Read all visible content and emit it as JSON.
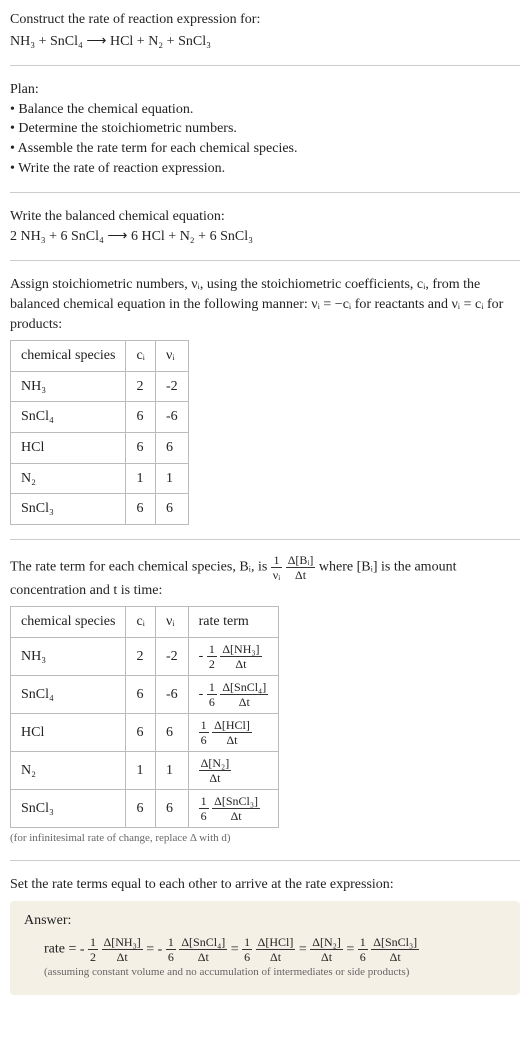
{
  "prompt": {
    "title": "Construct the rate of reaction expression for:",
    "equation": "NH₃ + SnCl₄ ⟶ HCl + N₂ + SnCl₃"
  },
  "plan": {
    "title": "Plan:",
    "items": [
      "• Balance the chemical equation.",
      "• Determine the stoichiometric numbers.",
      "• Assemble the rate term for each chemical species.",
      "• Write the rate of reaction expression."
    ]
  },
  "balanced": {
    "title": "Write the balanced chemical equation:",
    "equation": "2 NH₃ + 6 SnCl₄ ⟶ 6 HCl + N₂ + 6 SnCl₃"
  },
  "assign": {
    "intro": "Assign stoichiometric numbers, νᵢ, using the stoichiometric coefficients, cᵢ, from the balanced chemical equation in the following manner: νᵢ = −cᵢ for reactants and νᵢ = cᵢ for products:",
    "headers": [
      "chemical species",
      "cᵢ",
      "νᵢ"
    ],
    "rows": [
      {
        "sp": "NH₃",
        "c": "2",
        "v": "-2"
      },
      {
        "sp": "SnCl₄",
        "c": "6",
        "v": "-6"
      },
      {
        "sp": "HCl",
        "c": "6",
        "v": "6"
      },
      {
        "sp": "N₂",
        "c": "1",
        "v": "1"
      },
      {
        "sp": "SnCl₃",
        "c": "6",
        "v": "6"
      }
    ]
  },
  "rateterm": {
    "intro_a": "The rate term for each chemical species, Bᵢ, is ",
    "frac1_num": "1",
    "frac1_den": "νᵢ",
    "frac2_num": "Δ[Bᵢ]",
    "frac2_den": "Δt",
    "intro_b": " where [Bᵢ] is the amount concentration and t is time:",
    "headers": [
      "chemical species",
      "cᵢ",
      "νᵢ",
      "rate term"
    ],
    "rows": [
      {
        "sp": "NH₃",
        "c": "2",
        "v": "-2",
        "coef": "- ",
        "cn": "1",
        "cd": "2",
        "bn": "Δ[NH₃]",
        "bd": "Δt"
      },
      {
        "sp": "SnCl₄",
        "c": "6",
        "v": "-6",
        "coef": "- ",
        "cn": "1",
        "cd": "6",
        "bn": "Δ[SnCl₄]",
        "bd": "Δt"
      },
      {
        "sp": "HCl",
        "c": "6",
        "v": "6",
        "coef": "",
        "cn": "1",
        "cd": "6",
        "bn": "Δ[HCl]",
        "bd": "Δt"
      },
      {
        "sp": "N₂",
        "c": "1",
        "v": "1",
        "coef": "",
        "cn": "",
        "cd": "",
        "bn": "Δ[N₂]",
        "bd": "Δt"
      },
      {
        "sp": "SnCl₃",
        "c": "6",
        "v": "6",
        "coef": "",
        "cn": "1",
        "cd": "6",
        "bn": "Δ[SnCl₃]",
        "bd": "Δt"
      }
    ],
    "note": "(for infinitesimal rate of change, replace Δ with d)"
  },
  "final": {
    "title": "Set the rate terms equal to each other to arrive at the rate expression:",
    "answer_label": "Answer:",
    "rate_prefix": "rate = ",
    "terms": [
      {
        "pre": "- ",
        "cn": "1",
        "cd": "2",
        "bn": "Δ[NH₃]",
        "bd": "Δt"
      },
      {
        "pre": " = - ",
        "cn": "1",
        "cd": "6",
        "bn": "Δ[SnCl₄]",
        "bd": "Δt"
      },
      {
        "pre": " = ",
        "cn": "1",
        "cd": "6",
        "bn": "Δ[HCl]",
        "bd": "Δt"
      },
      {
        "pre": " = ",
        "cn": "",
        "cd": "",
        "bn": "Δ[N₂]",
        "bd": "Δt"
      },
      {
        "pre": " = ",
        "cn": "1",
        "cd": "6",
        "bn": "Δ[SnCl₃]",
        "bd": "Δt"
      }
    ],
    "note": "(assuming constant volume and no accumulation of intermediates or side products)"
  }
}
